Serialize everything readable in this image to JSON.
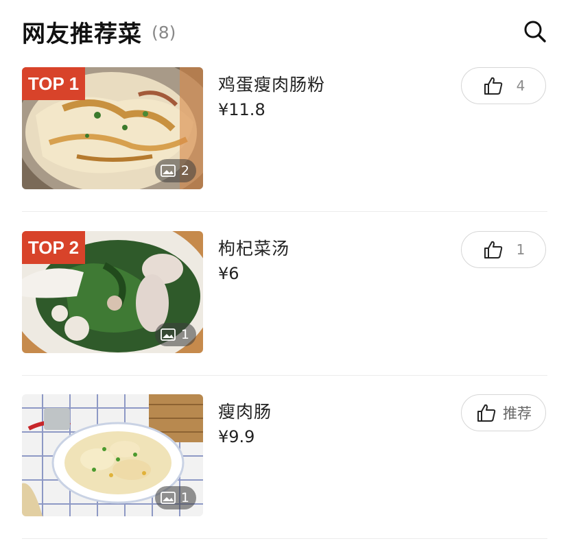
{
  "header": {
    "title": "网友推荐菜",
    "count": "(8)",
    "search_icon": "search-icon"
  },
  "dishes": [
    {
      "rank": "TOP 1",
      "name": "鸡蛋瘦肉肠粉",
      "price": "¥11.8",
      "photo_count": "2",
      "likes": "4"
    },
    {
      "rank": "TOP 2",
      "name": "枸杞菜汤",
      "price": "¥6",
      "photo_count": "1",
      "likes": "1"
    },
    {
      "name": "瘦肉肠",
      "price": "¥9.9",
      "photo_count": "1",
      "like_label": "推荐"
    }
  ],
  "colors": {
    "badge": "#d8432a",
    "divider": "#ececec"
  }
}
